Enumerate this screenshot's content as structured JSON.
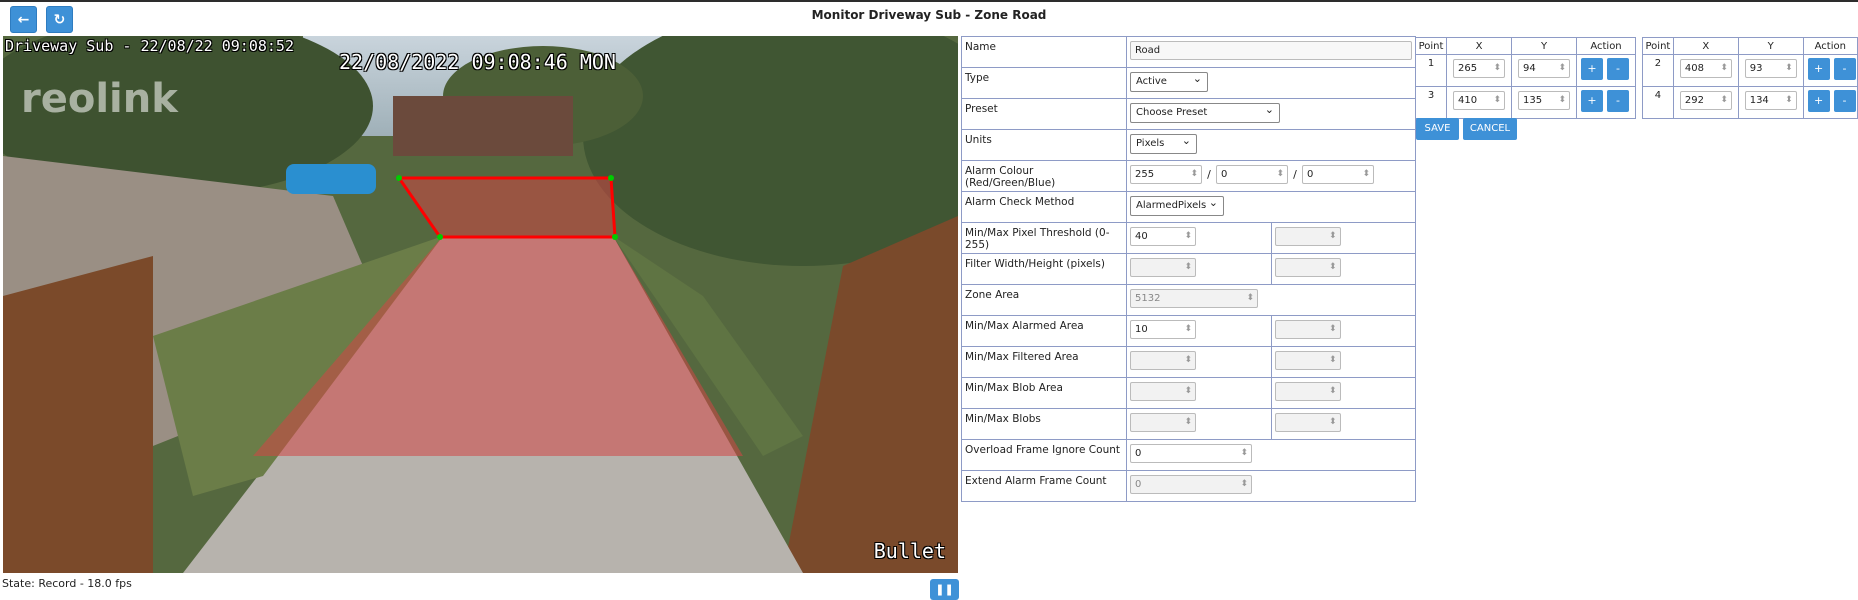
{
  "header": {
    "title": "Monitor Driveway Sub - Zone Road",
    "back_icon": "arrow-left-icon",
    "refresh_icon": "refresh-icon"
  },
  "camera": {
    "osd_top_left": "Driveway Sub - 22/08/22 09:08:52",
    "osd_timestamp": "22/08/2022 09:08:46 MON",
    "osd_bottom_right": "Bullet",
    "logo_watermark": "reolink",
    "zone_color": "#ff0000"
  },
  "status": {
    "text": "State: Record - 18.0 fps",
    "pause_icon": "pause-icon"
  },
  "form": {
    "name_label": "Name",
    "name_value": "Road",
    "type_label": "Type",
    "type_value": "Active",
    "preset_label": "Preset",
    "preset_value": "Choose Preset",
    "units_label": "Units",
    "units_value": "Pixels",
    "alarm_colour_label": "Alarm Colour (Red/Green/Blue)",
    "alarm_red": "255",
    "alarm_green": "0",
    "alarm_blue": "0",
    "slash": "/",
    "check_method_label": "Alarm Check Method",
    "check_method_value": "AlarmedPixels",
    "pixel_threshold_label": "Min/Max Pixel Threshold (0-255)",
    "pixel_threshold_min": "40",
    "pixel_threshold_max": "",
    "filter_label": "Filter Width/Height (pixels)",
    "filter_width": "",
    "filter_height": "",
    "zone_area_label": "Zone Area",
    "zone_area_value": "5132",
    "alarmed_area_label": "Min/Max Alarmed Area",
    "alarmed_area_min": "10",
    "alarmed_area_max": "",
    "filtered_area_label": "Min/Max Filtered Area",
    "filtered_area_min": "",
    "filtered_area_max": "",
    "blob_area_label": "Min/Max Blob Area",
    "blob_area_min": "",
    "blob_area_max": "",
    "blobs_label": "Min/Max Blobs",
    "blobs_min": "",
    "blobs_max": "",
    "overload_label": "Overload Frame Ignore Count",
    "overload_value": "0",
    "extend_label": "Extend Alarm Frame Count",
    "extend_value": "0"
  },
  "points_headers": {
    "point": "Point",
    "x": "X",
    "y": "Y",
    "action": "Action"
  },
  "points_left": [
    {
      "num": "1",
      "x": "265",
      "y": "94",
      "plus": "+",
      "minus": "-"
    },
    {
      "num": "3",
      "x": "410",
      "y": "135",
      "plus": "+",
      "minus": "-"
    }
  ],
  "points_right": [
    {
      "num": "2",
      "x": "408",
      "y": "93",
      "plus": "+",
      "minus": "-"
    },
    {
      "num": "4",
      "x": "292",
      "y": "134",
      "plus": "+",
      "minus": "-"
    }
  ],
  "buttons": {
    "save": "SAVE",
    "cancel": "CANCEL"
  },
  "colors": {
    "accent": "#3e91d7",
    "table_border": "#8e9bc6"
  }
}
